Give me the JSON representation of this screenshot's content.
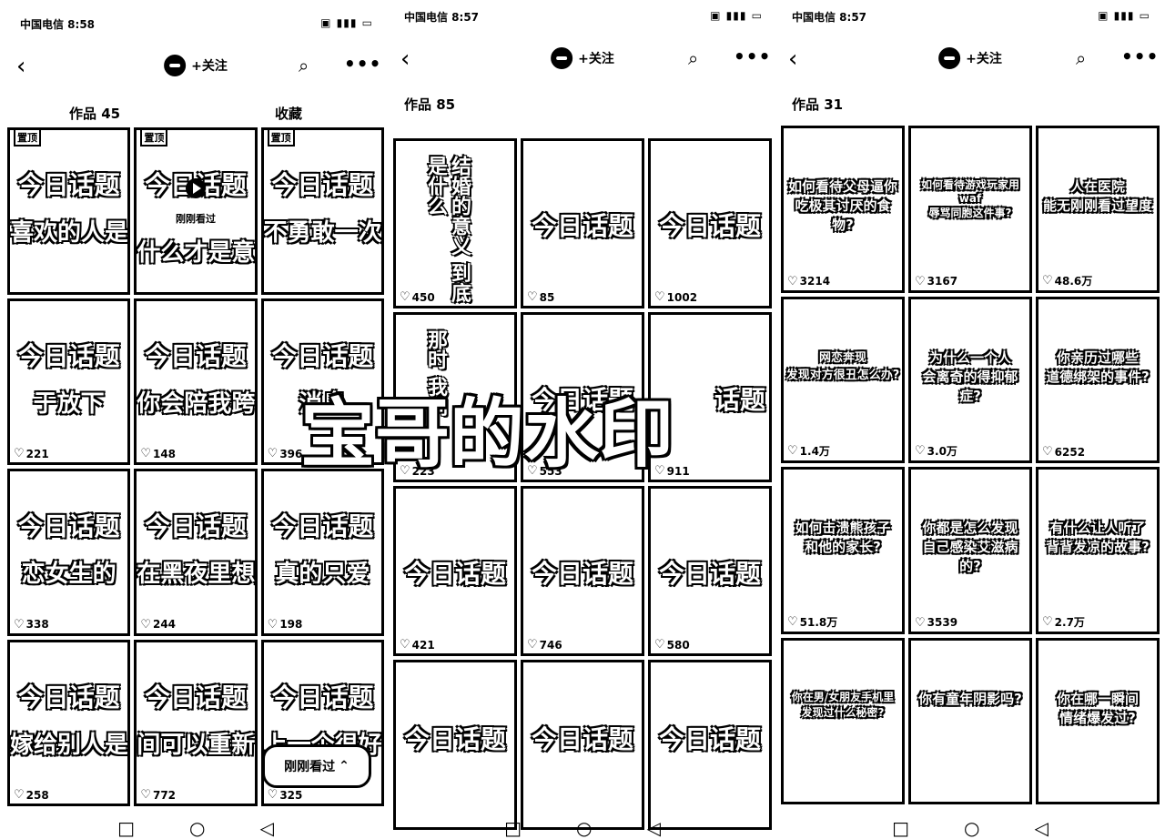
{
  "watermark": "宝哥的水印",
  "resume_pill": {
    "label": "刚刚看过",
    "icon": "chevron-up-icon"
  },
  "phones": [
    {
      "status": {
        "carrier": "中国电信 8:58",
        "icons": "▣ ▮▮▮ ▭"
      },
      "nav": {
        "back": "‹",
        "follow": "+关注",
        "search": "⌕",
        "more": "•••"
      },
      "tabs": [
        "作品 45",
        "收藏"
      ],
      "items": [
        {
          "title": "今日话题",
          "sub": "喜欢的人是什",
          "likes": "",
          "badge": "置顶"
        },
        {
          "title": "今日话题",
          "sub": "什么才是意",
          "likes": "",
          "badge": "置顶",
          "viewed": "刚刚看过"
        },
        {
          "title": "今日话题",
          "sub": "不勇敢一次",
          "likes": "",
          "badge": "置顶"
        },
        {
          "title": "今日话题",
          "sub": "于放下",
          "likes": "221"
        },
        {
          "title": "今日话题",
          "sub": "你会陪我跨",
          "likes": "148"
        },
        {
          "title": "今日话题",
          "sub": "消息",
          "likes": "396"
        },
        {
          "title": "今日话题",
          "sub": "恋女生的",
          "likes": "338"
        },
        {
          "title": "今日话题",
          "sub": "在黑夜里想起",
          "likes": "244"
        },
        {
          "title": "今日话题",
          "sub": "真的只爱",
          "likes": "198"
        },
        {
          "title": "今日话题",
          "sub": "嫁给别人是",
          "likes": "258"
        },
        {
          "title": "今日话题",
          "sub": "间可以重新",
          "likes": "772"
        },
        {
          "title": "今日话题",
          "sub": "上一个很好",
          "likes": "325"
        }
      ]
    },
    {
      "status": {
        "carrier": "中国电信 8:57",
        "icons": "▣ ▮▮▮ ▭"
      },
      "nav": {
        "back": "‹",
        "follow": "+关注",
        "search": "⌕",
        "more": "•••"
      },
      "tabs": [
        "作品 85"
      ],
      "items": [
        {
          "vertical": "结婚的意义\n到底是什么",
          "likes": "450"
        },
        {
          "title": "今日话题",
          "likes": "85"
        },
        {
          "title": "今日话题",
          "likes": "1002"
        },
        {
          "vertical": "那时\n我们",
          "likes": "223"
        },
        {
          "title": "今日话题",
          "likes": "553"
        },
        {
          "title": "话题",
          "likes": "911"
        },
        {
          "title": "今日话题",
          "likes": "421"
        },
        {
          "title": "今日话题",
          "likes": "746"
        },
        {
          "title": "今日话题",
          "likes": "580"
        },
        {
          "title": "今日话题",
          "likes": ""
        },
        {
          "title": "今日话题",
          "likes": ""
        },
        {
          "title": "今日话题",
          "likes": ""
        }
      ]
    },
    {
      "status": {
        "carrier": "中国电信 8:57",
        "icons": "▣ ▮▮▮ ▭"
      },
      "nav": {
        "back": "‹",
        "follow": "+关注",
        "search": "⌕",
        "more": "•••"
      },
      "tabs": [
        "作品 31"
      ],
      "items": [
        {
          "q": "如何看待父母逼你\n吃极其讨厌的食物?",
          "likes": "3214"
        },
        {
          "q": "如何看待游戏玩家用waf\n辱骂同胞这件事?",
          "likes": "3167"
        },
        {
          "q": "人在医院\n能无刚刚看过望度",
          "likes": "48.6万"
        },
        {
          "q": "网恋奔现\n发现对方很丑怎么办?",
          "likes": "1.4万"
        },
        {
          "q": "为什么一个人\n会离奇的得抑郁症?",
          "likes": "3.0万"
        },
        {
          "q": "你亲历过哪些\n道德绑架的事件?",
          "likes": "6252"
        },
        {
          "q": "如何击溃熊孩子\n和他的家长?",
          "likes": "51.8万"
        },
        {
          "q": "你都是怎么发现\n自己感染艾滋病的?",
          "likes": "3539"
        },
        {
          "q": "有什么让人听了\n背背发凉的故事?",
          "likes": "2.7万"
        },
        {
          "q": "你在男/女朋友手机里\n发现过什么秘密?",
          "likes": ""
        },
        {
          "q": "你有童年阴影吗?",
          "likes": ""
        },
        {
          "q": "你在哪一瞬间\n情绪爆发过?",
          "likes": ""
        }
      ]
    }
  ],
  "bottom_nav": [
    "□",
    "○",
    "◁"
  ]
}
